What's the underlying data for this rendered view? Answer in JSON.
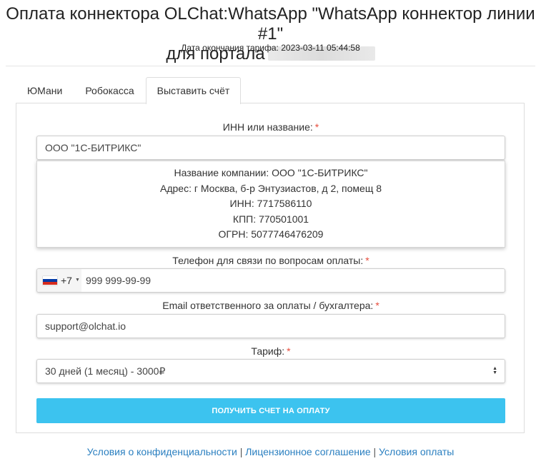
{
  "header": {
    "title_line1": "Оплата коннектора OLChat:WhatsApp \"WhatsApp коннектор линии #1\"",
    "title_line2": "для портала",
    "tariff_end": "Дата окончания тарифа: 2023-03-11 05:44:58"
  },
  "tabs": [
    {
      "label": "ЮМани",
      "active": false
    },
    {
      "label": "Робокасса",
      "active": false
    },
    {
      "label": "Выставить счёт",
      "active": true
    }
  ],
  "form": {
    "inn": {
      "label": "ИНН или название:",
      "required_mark": "*",
      "value": "ООО \"1С-БИТРИКС\""
    },
    "company": {
      "name": "Название компании: ООО \"1С-БИТРИКС\"",
      "address": "Адрес: г Москва, б-р Энтузиастов, д 2, помещ 8",
      "inn": "ИНН: 7717586110",
      "kpp": "КПП: 770501001",
      "ogrn": "ОГРН: 5077746476209"
    },
    "phone": {
      "label": "Телефон для связи по вопросам оплаты:",
      "required_mark": "*",
      "country_code": "+7",
      "flag_colors": [
        "#ffffff",
        "#0039a6",
        "#d52b1e"
      ],
      "value": "999 999-99-99"
    },
    "email": {
      "label": "Email ответственного за оплаты / бухгалтера:",
      "required_mark": "*",
      "value": "support@olchat.io"
    },
    "tariff": {
      "label": "Тариф:",
      "required_mark": "*",
      "selected": "30 дней (1 месяц) - 3000₽"
    },
    "submit_label": "ПОЛУЧИТЬ СЧЕТ НА ОПЛАТУ"
  },
  "footer": {
    "privacy": "Условия о конфиденциальности",
    "license": "Лицензионное соглашение",
    "payment_terms": "Условия оплаты",
    "separator": "|"
  },
  "colors": {
    "accent": "#3cc3ef",
    "link": "#2a7fc0",
    "required": "#e74c3c"
  }
}
